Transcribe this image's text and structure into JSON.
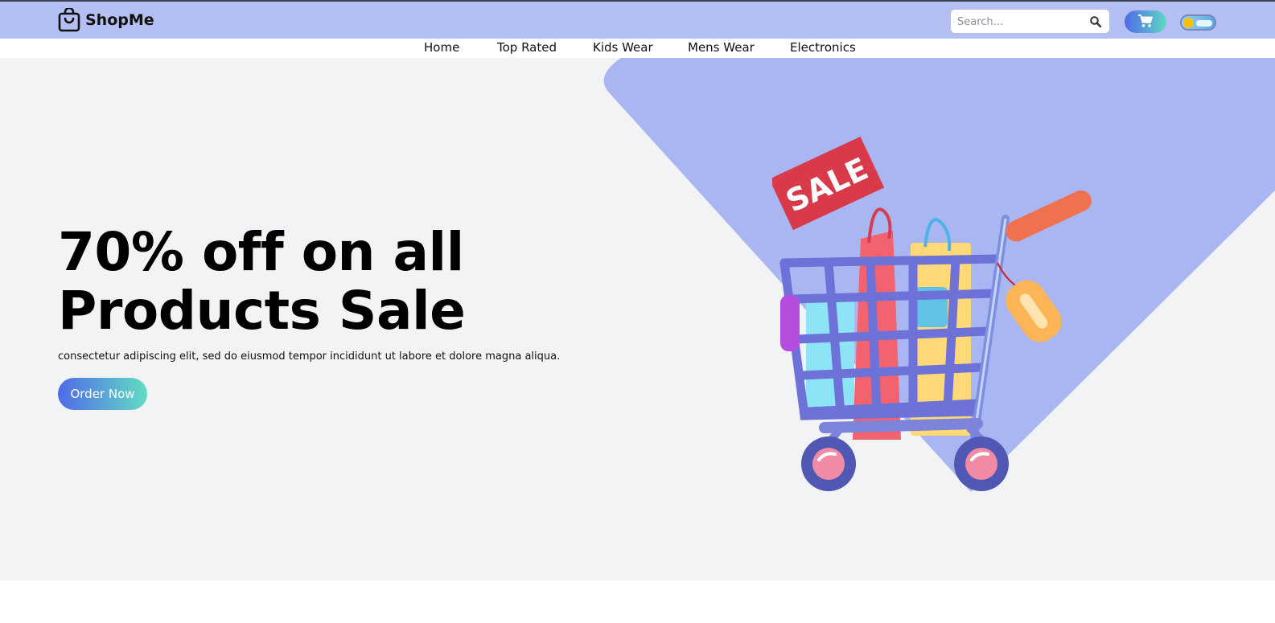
{
  "header": {
    "brand": "ShopMe",
    "search": {
      "placeholder": "Search..."
    },
    "colors": {
      "header_bg": "#b4bff4",
      "accent_start": "#4f6ae8",
      "accent_end": "#5fd7c4"
    }
  },
  "nav": {
    "items": [
      {
        "label": "Home"
      },
      {
        "label": "Top Rated"
      },
      {
        "label": "Kids Wear"
      },
      {
        "label": "Mens Wear"
      },
      {
        "label": "Electronics"
      }
    ]
  },
  "hero": {
    "headline_line1": "70% off on all",
    "headline_line2": "Products Sale",
    "subtext": "consectetur adipiscing elit, sed do eiusmod tempor incididunt ut labore et dolore magna aliqua.",
    "cta_label": "Order Now",
    "illustration": {
      "tag_text": "SALE"
    },
    "colors": {
      "background": "#f2f3f5",
      "shape": "#a9b6f1",
      "sale_tag": "#d93a4a"
    }
  },
  "icons": {
    "logo": "shopping-bag-icon",
    "search": "search-icon",
    "cart": "cart-icon",
    "theme": "theme-toggle-icon"
  }
}
